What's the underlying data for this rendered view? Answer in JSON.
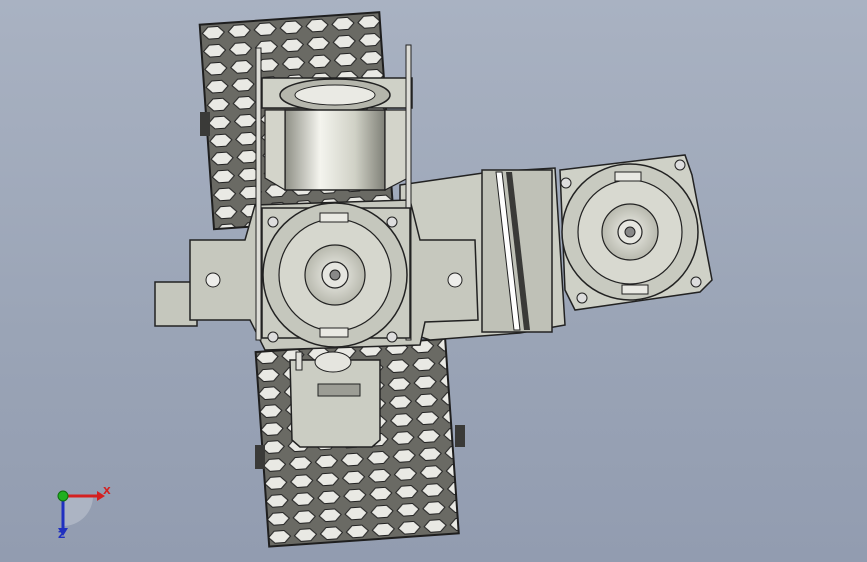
{
  "viewport": {
    "background_top": "#a9b2c2",
    "background_bottom": "#929cb0"
  },
  "model": {
    "metal_color": "#c9cbc1",
    "edge_color": "#2a2a2a",
    "tread_color": "#5a5a55",
    "accent_white": "#ffffff"
  },
  "triad": {
    "x_label": "X",
    "z_label": "Z",
    "x_color": "#d42020",
    "y_color": "#20b020",
    "z_color": "#2030c0"
  }
}
